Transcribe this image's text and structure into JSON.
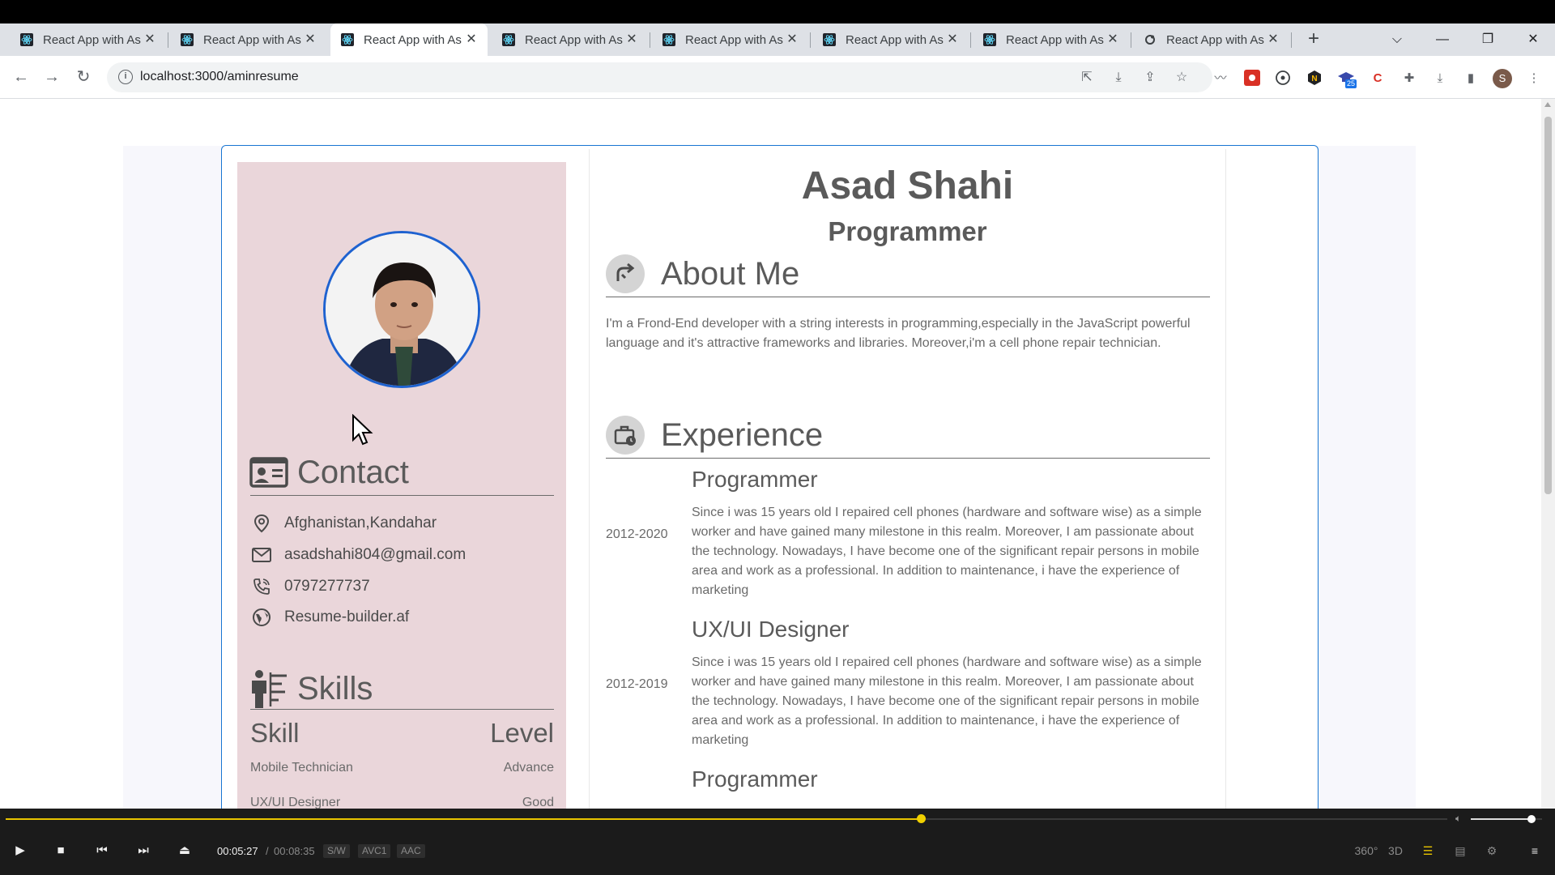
{
  "browser": {
    "tabs": [
      {
        "title": "React App with As",
        "active": false
      },
      {
        "title": "React App with As",
        "active": false
      },
      {
        "title": "React App with As",
        "active": true
      },
      {
        "title": "React App with As",
        "active": false
      },
      {
        "title": "React App with As",
        "active": false
      },
      {
        "title": "React App with As",
        "active": false
      },
      {
        "title": "React App with As",
        "active": false
      },
      {
        "title": "React App with As",
        "active": false
      }
    ],
    "url": "localhost:3000/aminresume",
    "extension_badge": "25",
    "profile_initial": "S"
  },
  "resume": {
    "name": "Asad Shahi",
    "role": "Programmer",
    "contact_title": "Contact",
    "contacts": [
      {
        "icon": "location-icon",
        "text": "Afghanistan,Kandahar"
      },
      {
        "icon": "mail-icon",
        "text": "asadshahi804@gmail.com"
      },
      {
        "icon": "phone-icon",
        "text": "0797277737"
      },
      {
        "icon": "globe-icon",
        "text": "Resume-builder.af"
      }
    ],
    "skills_title": "Skills",
    "skill_col": "Skill",
    "level_col": "Level",
    "skills": [
      {
        "skill": "Mobile Technician",
        "level": "Advance"
      },
      {
        "skill": "UX/UI Designer",
        "level": "Good"
      }
    ],
    "about_title": "About Me",
    "about_text": "I'm a Frond-End developer with a string interests in programming,especially in the JavaScript powerful language and it's attractive frameworks and libraries. Moreover,i'm a cell phone repair technician.",
    "experience_title": "Experience",
    "experience": [
      {
        "title": "Programmer",
        "years": "2012-2020",
        "desc": "Since i was 15 years old I repaired cell phones (hardware and software wise) as a simple worker and have gained many milestone in this realm. Moreover, I am passionate about the technology. Nowadays, I have become one of the significant repair persons in mobile area and work as a professional. In addition to maintenance, i have the experience of marketing"
      },
      {
        "title": "UX/UI Designer",
        "years": "2012-2019",
        "desc": "Since i was 15 years old I repaired cell phones (hardware and software wise) as a simple worker and have gained many milestone in this realm. Moreover, I am passionate about the technology. Nowadays, I have become one of the significant repair persons in mobile area and work as a professional. In addition to maintenance, i have the experience of marketing"
      },
      {
        "title": "Programmer",
        "years": "",
        "desc": ""
      }
    ]
  },
  "player": {
    "current_time": "00:05:27",
    "separator": "/",
    "total_time": "00:08:35",
    "progress_fraction": 0.635,
    "volume_fraction": 0.85,
    "badges": [
      "S/W",
      "AVC1",
      "AAC"
    ],
    "labels": {
      "vr": "360°",
      "three_d": "3D"
    }
  },
  "colors": {
    "accent": "#1976d2",
    "sidebar": "#ead6da",
    "seek": "#e8c400"
  }
}
